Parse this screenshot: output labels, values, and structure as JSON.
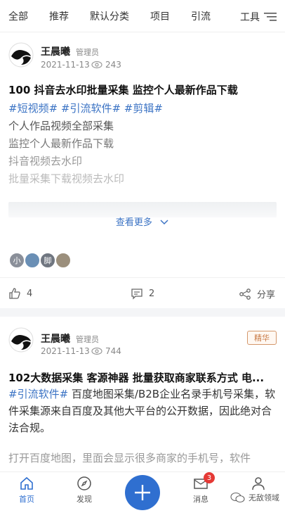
{
  "tabs": [
    "全部",
    "推荐",
    "默认分类",
    "项目",
    "引流",
    "工具"
  ],
  "post1": {
    "author": "王晨曦",
    "role": "管理员",
    "date": "2021-11-13",
    "views": "243",
    "title": "100 抖音去水印批量采集 监控个人最新作品下载",
    "tags": "#短视频# #引流软件# #剪辑#",
    "lines": [
      "个人作品视频全部采集",
      "监控个人最新作品下载",
      "抖音视频去水印",
      "批量采集下载视频去水印"
    ],
    "more": "查看更多",
    "likers": [
      "小",
      "",
      "脚",
      ""
    ],
    "likes": "4",
    "comments": "2",
    "share": "分享"
  },
  "post2": {
    "author": "王晨曦",
    "role": "管理员",
    "date": "2021-11-13",
    "views": "744",
    "badge": "精华",
    "title": "102大数据采集 客源神器 批量获取商家联系方式 电...",
    "tag": "#引流软件#",
    "body": " 百度地图采集/B2B企业名录手机号采集，软件采集源来自百度及其他大平台的公开数据，因此绝对合法合规。",
    "body2": "打开百度地图，里面会显示很多商家的手机号，软件"
  },
  "bottom_nav": {
    "home": "首页",
    "discover": "发现",
    "messages": "消息",
    "message_count": "3",
    "watermark": "无敌领域"
  },
  "colors": {
    "accent": "#2f6fd0",
    "tag": "#3b73c4",
    "badge": "#c97a45"
  }
}
